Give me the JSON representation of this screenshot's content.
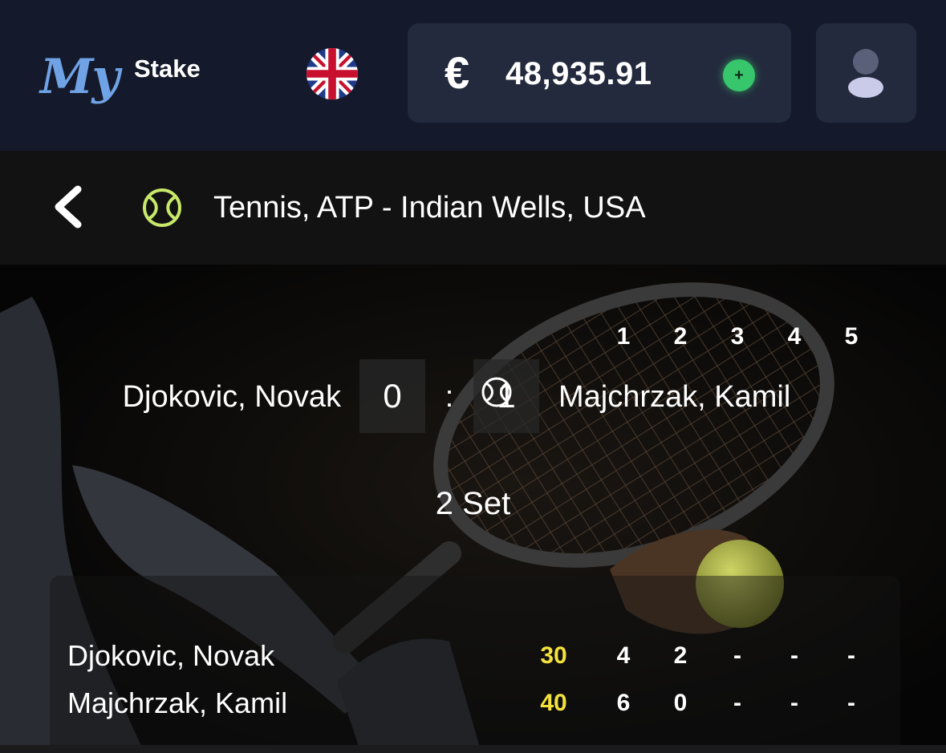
{
  "header": {
    "logo": {
      "my": "My",
      "stake": "Stake"
    },
    "language_flag": "uk-flag-icon",
    "balance": {
      "currency_symbol": "€",
      "amount": "48,935.91",
      "deposit_icon": "+"
    },
    "profile_icon": "user-icon"
  },
  "breadcrumb": {
    "back_icon": "chevron-left-icon",
    "sport_icon": "tennis-ball-icon",
    "title": "Tennis, ATP - Indian Wells, USA"
  },
  "match": {
    "player1": "Djokovic, Novak",
    "player2": "Majchrzak, Kamil",
    "score1": "0",
    "separator": ":",
    "score2": "1",
    "current_set": "2 Set"
  },
  "scoreboard": {
    "set_headers": [
      "1",
      "2",
      "3",
      "4",
      "5"
    ],
    "rows": [
      {
        "name": "Djokovic, Novak",
        "serving": true,
        "points": "30",
        "sets": [
          "4",
          "2",
          "-",
          "-",
          "-"
        ]
      },
      {
        "name": "Majchrzak, Kamil",
        "serving": false,
        "points": "40",
        "sets": [
          "6",
          "0",
          "-",
          "-",
          "-"
        ]
      }
    ]
  },
  "colors": {
    "header_bg": "#141a2b",
    "panel_bg": "#232a3d",
    "accent_green": "#37c66b",
    "points_yellow": "#f4e23c",
    "logo_blue": "#6fa3e6",
    "ball_green": "#c7e86a"
  }
}
